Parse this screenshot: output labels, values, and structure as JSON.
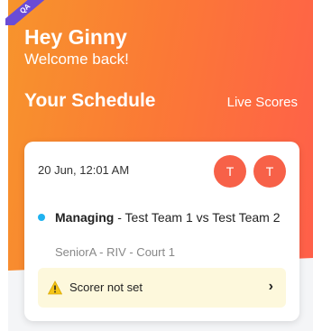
{
  "ribbon_text": "QA",
  "header": {
    "greeting": "Hey Ginny",
    "welcome": "Welcome back!",
    "schedule_title": "Your Schedule",
    "live_scores_label": "Live Scores"
  },
  "card": {
    "datetime": "20 Jun, 12:01 AM",
    "avatars": [
      "T",
      "T"
    ],
    "role": "Managing",
    "match": " - Test Team 1 vs Test Team 2",
    "details": "SeniorA - RIV - Court 1",
    "scorer_status": "Scorer not set",
    "chevron": "›"
  },
  "colors": {
    "gradient_start": "#f7942c",
    "gradient_end": "#ff5f4a",
    "avatar": "#f76148",
    "status_dot": "#1fb2f0",
    "warning_bg": "#fdf8dc"
  }
}
